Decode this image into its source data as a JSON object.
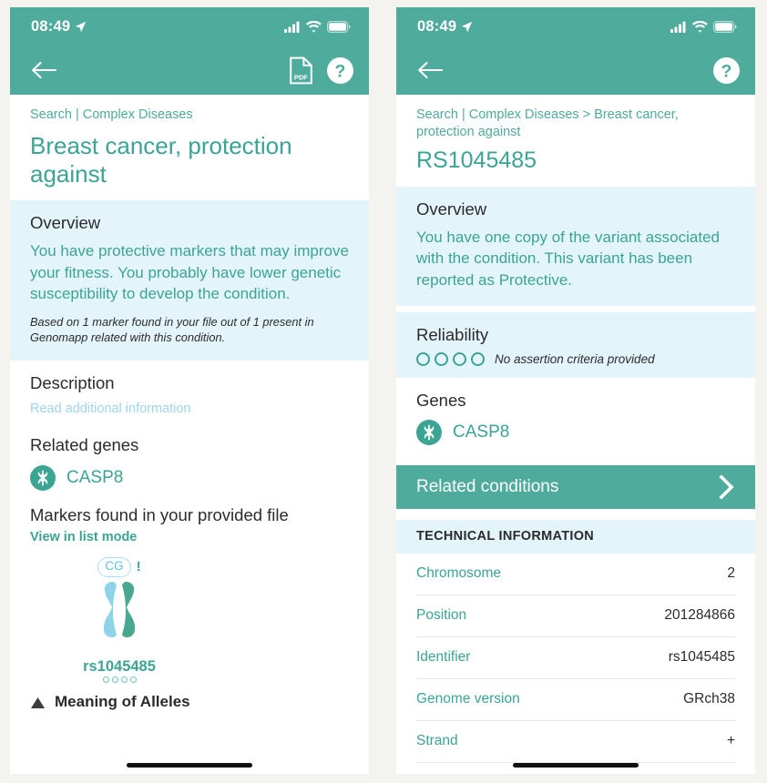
{
  "status_bar": {
    "time": "08:49",
    "location_icon": "location-arrow-icon",
    "signal_icon": "cellular-signal-icon",
    "wifi_icon": "wifi-icon",
    "battery_icon": "battery-icon"
  },
  "left_screen": {
    "nav": {
      "back_icon": "back-arrow-icon",
      "pdf_icon": "pdf-document-icon",
      "pdf_label": "PDF",
      "help_icon": "help-question-icon"
    },
    "breadcrumb": "Search | Complex Diseases",
    "title": "Breast cancer, protection against",
    "overview": {
      "heading": "Overview",
      "body": "You have protective markers that may improve your fitness. You probably have lower genetic susceptibility to develop the condition.",
      "note": "Based on 1 marker found in your file out of 1 present in Genomapp related with this condition."
    },
    "description": {
      "heading": "Description",
      "link": "Read additional information"
    },
    "related_genes": {
      "heading": "Related genes",
      "gene_icon": "dna-gene-icon",
      "gene": "CASP8"
    },
    "markers": {
      "heading": "Markers found in your provided file",
      "link": "View in list mode",
      "marker": {
        "alleles": "CG",
        "flag": "!",
        "id": "rs1045485",
        "reliability_dots": 4,
        "reliability_filled": 0,
        "chromosome_icon": "chromosome-icon"
      }
    },
    "footer_clipped": {
      "icon": "triangle-up-icon",
      "label": "Meaning of Alleles"
    }
  },
  "right_screen": {
    "nav": {
      "back_icon": "back-arrow-icon",
      "help_icon": "help-question-icon"
    },
    "breadcrumb": "Search | Complex Diseases > Breast cancer, protection against",
    "title": "RS1045485",
    "overview": {
      "heading": "Overview",
      "body": "You have one copy of the variant associated with the condition. This variant has been reported as Protective."
    },
    "reliability": {
      "heading": "Reliability",
      "dots_total": 4,
      "dots_filled": 0,
      "text": "No assertion criteria provided"
    },
    "genes": {
      "heading": "Genes",
      "gene_icon": "dna-gene-icon",
      "gene": "CASP8"
    },
    "related_conditions": {
      "label": "Related conditions",
      "chevron_icon": "chevron-right-icon"
    },
    "technical_information": {
      "heading": "TECHNICAL INFORMATION",
      "rows": [
        {
          "key": "Chromosome",
          "value": "2"
        },
        {
          "key": "Position",
          "value": "201284866"
        },
        {
          "key": "Identifier",
          "value": "rs1045485"
        },
        {
          "key": "Genome version",
          "value": "GRch38"
        },
        {
          "key": "Strand",
          "value": "+"
        }
      ]
    }
  },
  "colors": {
    "teal": "#4FAB9B",
    "teal_text": "#3BA493",
    "light_blue_bg": "#E3F4FB",
    "link_light": "#9FD4EC",
    "chromatid_light": "#8FD3E8",
    "chromatid_dark": "#49A88F",
    "page_bg": "#F5F3EF"
  }
}
